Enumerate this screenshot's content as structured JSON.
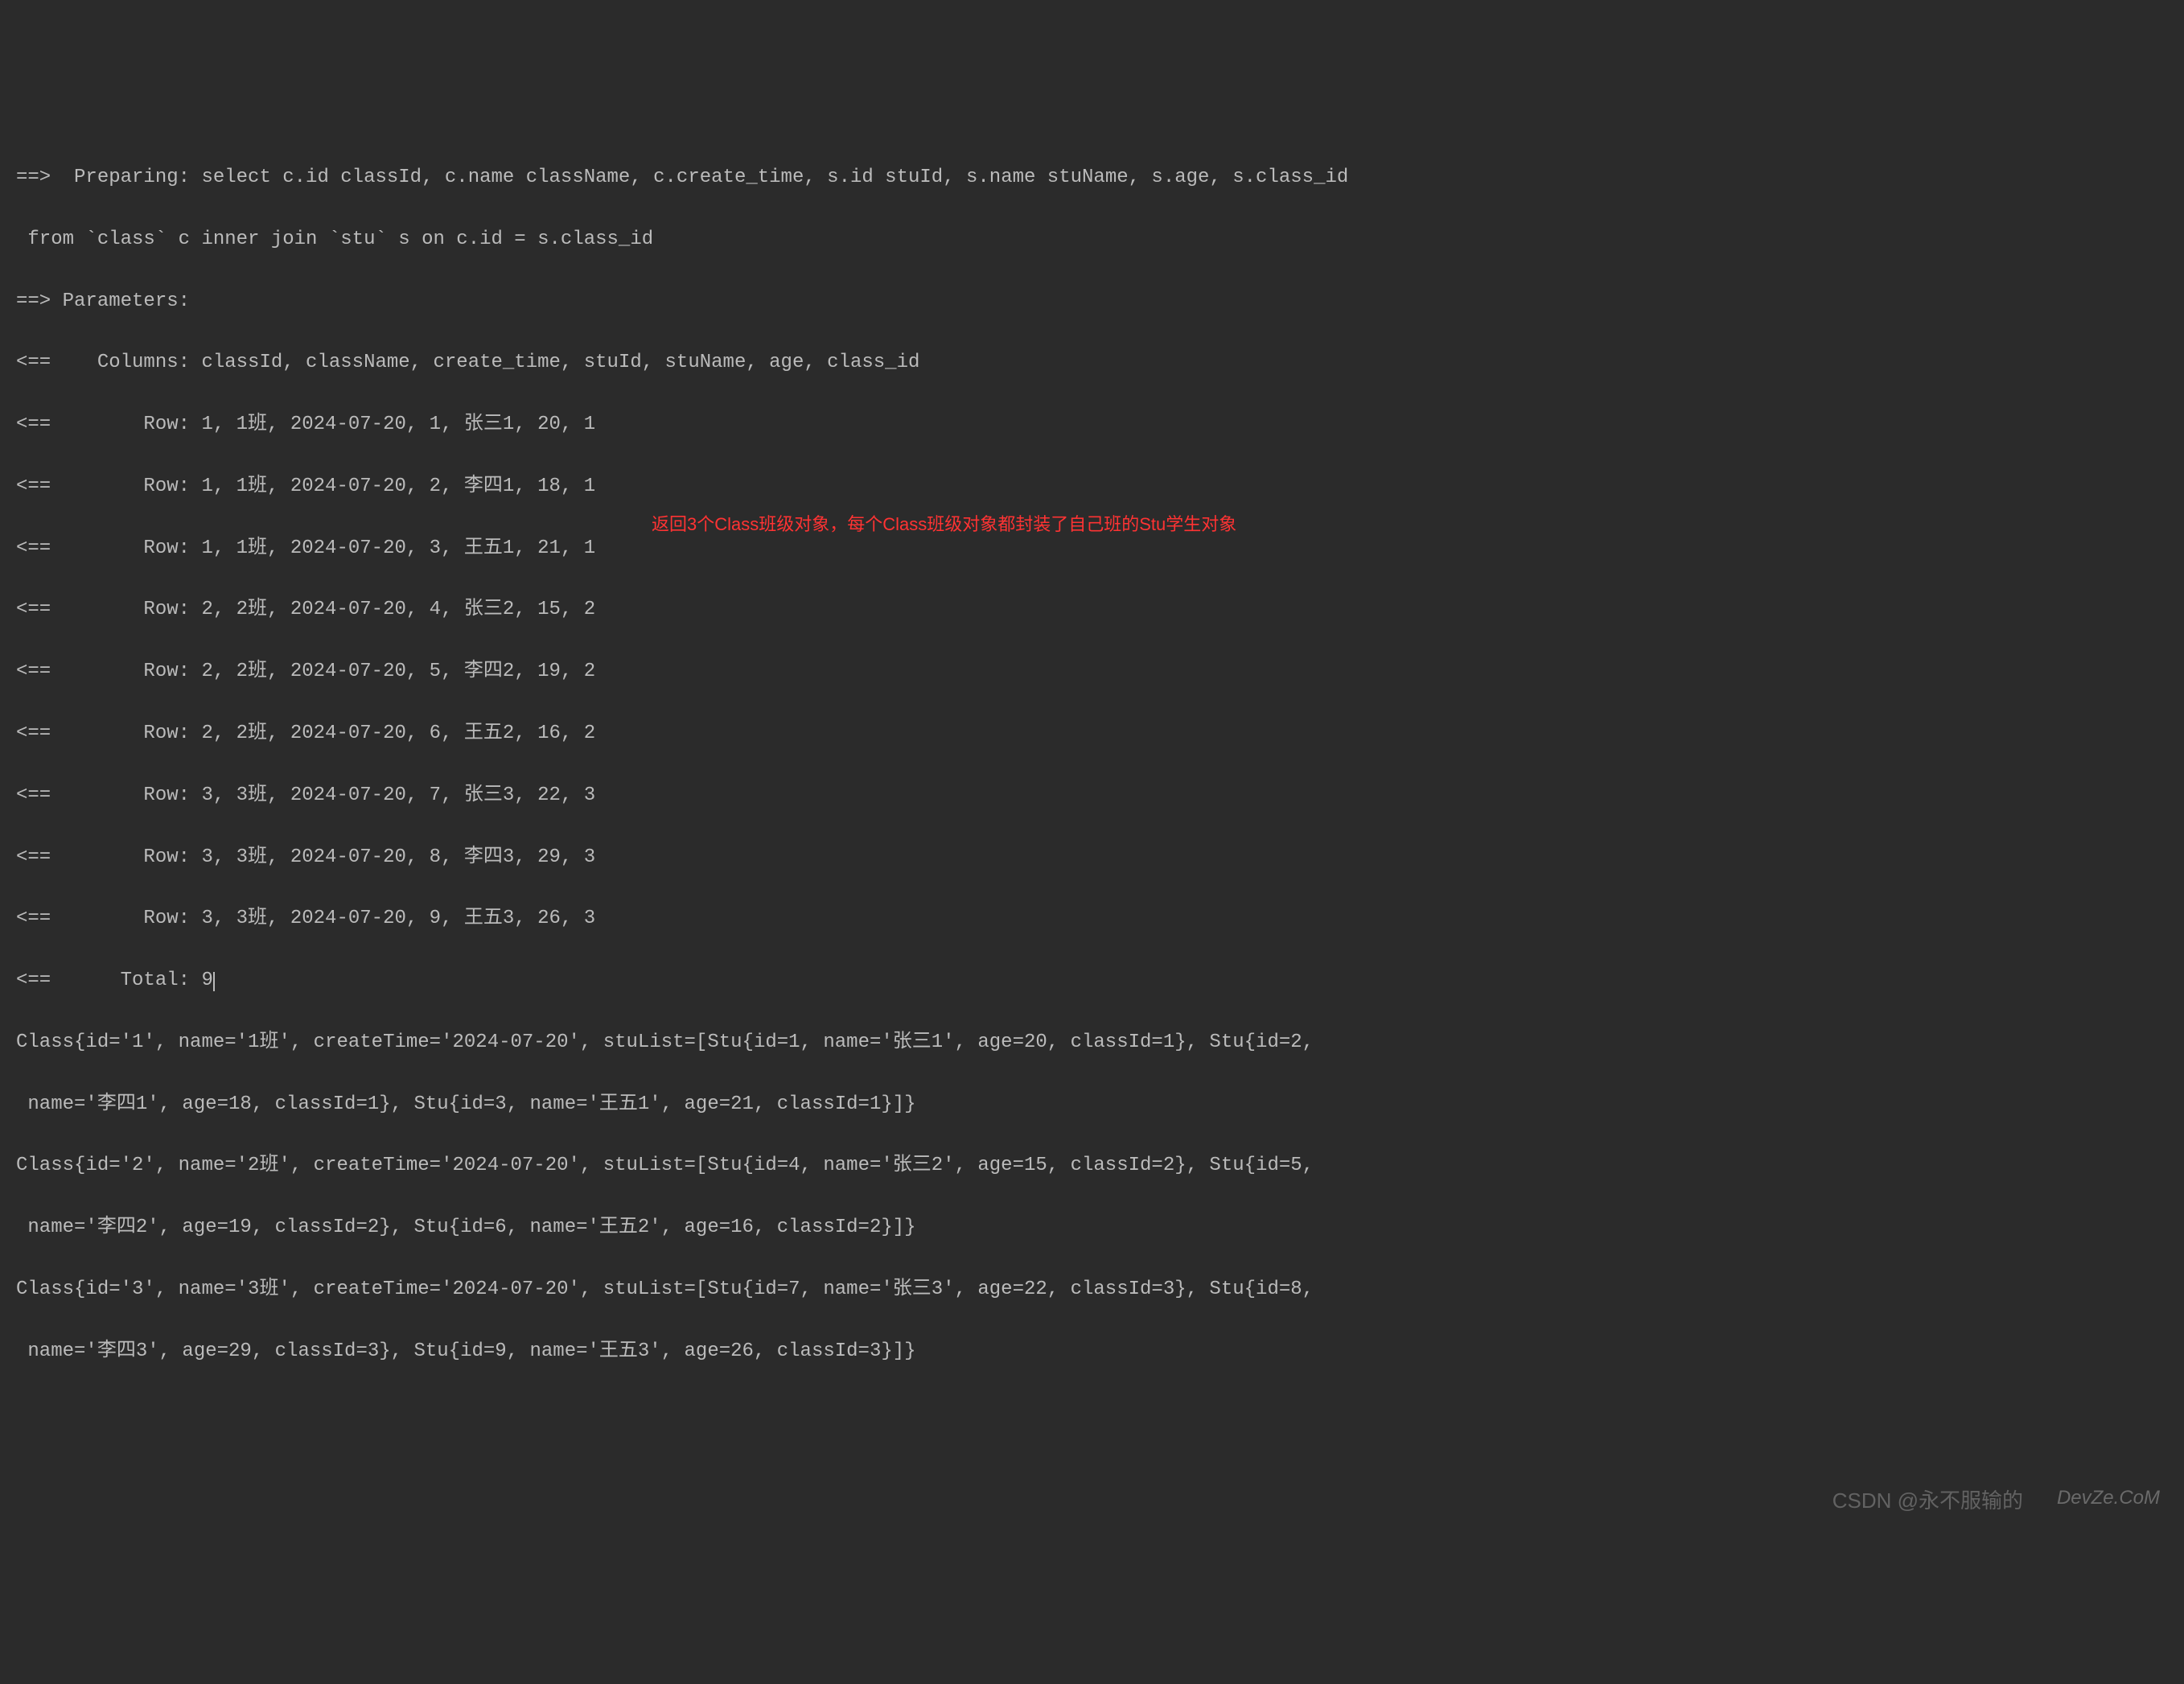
{
  "lines": {
    "prep1": "==>  Preparing: select c.id classId, c.name className, c.create_time, s.id stuId, s.name stuName, s.age, s.class_id",
    "prep2": " from `class` c inner join `stu` s on c.id = s.class_id",
    "params": "==> Parameters:",
    "columns": "<==    Columns: classId, className, create_time, stuId, stuName, age, class_id",
    "row1": "<==        Row: 1, 1班, 2024-07-20, 1, 张三1, 20, 1",
    "row2": "<==        Row: 1, 1班, 2024-07-20, 2, 李四1, 18, 1",
    "row3": "<==        Row: 1, 1班, 2024-07-20, 3, 王五1, 21, 1",
    "row4": "<==        Row: 2, 2班, 2024-07-20, 4, 张三2, 15, 2",
    "row5": "<==        Row: 2, 2班, 2024-07-20, 5, 李四2, 19, 2",
    "row6": "<==        Row: 2, 2班, 2024-07-20, 6, 王五2, 16, 2",
    "row7": "<==        Row: 3, 3班, 2024-07-20, 7, 张三3, 22, 3",
    "row8": "<==        Row: 3, 3班, 2024-07-20, 8, 李四3, 29, 3",
    "row9": "<==        Row: 3, 3班, 2024-07-20, 9, 王五3, 26, 3",
    "total": "<==      Total: 9",
    "class1a": "Class{id='1', name='1班', createTime='2024-07-20', stuList=[Stu{id=1, name='张三1', age=20, classId=1}, Stu{id=2,",
    "class1b": " name='李四1', age=18, classId=1}, Stu{id=3, name='王五1', age=21, classId=1}]}",
    "class2a": "Class{id='2', name='2班', createTime='2024-07-20', stuList=[Stu{id=4, name='张三2', age=15, classId=2}, Stu{id=5,",
    "class2b": " name='李四2', age=19, classId=2}, Stu{id=6, name='王五2', age=16, classId=2}]}",
    "class3a": "Class{id='3', name='3班', createTime='2024-07-20', stuList=[Stu{id=7, name='张三3', age=22, classId=3}, Stu{id=8,",
    "class3b": " name='李四3', age=29, classId=3}, Stu{id=9, name='王五3', age=26, classId=3}]}"
  },
  "annotation": "返回3个Class班级对象，每个Class班级对象都封装了自己班的Stu学生对象",
  "watermark1": "CSDN @永不服输的",
  "watermark2": "DevZe.CoM"
}
